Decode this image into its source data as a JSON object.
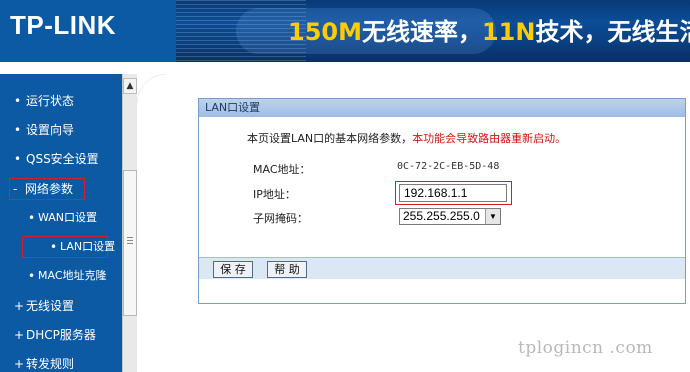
{
  "header": {
    "logo": "TP-LINK",
    "banner": {
      "part1": "150M",
      "part2": "无线速率，",
      "part3": "11N",
      "part4": "技术，无线生活"
    }
  },
  "sidebar": {
    "items": [
      {
        "label": "运行状态"
      },
      {
        "label": "设置向导"
      },
      {
        "label": "QSS安全设置"
      },
      {
        "label": "网络参数"
      },
      {
        "label": "WAN口设置"
      },
      {
        "label": "LAN口设置"
      },
      {
        "label": "MAC地址克隆"
      },
      {
        "label": "无线设置"
      },
      {
        "label": "DHCP服务器"
      },
      {
        "label": "转发规则"
      }
    ],
    "bullets": {
      "dot": "•",
      "minus": "-",
      "plus": "+"
    }
  },
  "scrollbar": {
    "up_arrow": "▲"
  },
  "panel": {
    "title": "LAN口设置",
    "description": "本页设置LAN口的基本网络参数，",
    "warning": "本功能会导致路由器重新启动。",
    "mac_label": "MAC地址：",
    "mac_value": "0C-72-2C-EB-5D-48",
    "ip_label": "IP地址：",
    "ip_value": "192.168.1.1",
    "mask_label": "子网掩码：",
    "mask_value": "255.255.255.0",
    "mask_arrow": "▼"
  },
  "buttons": {
    "save": "保 存",
    "help": "帮 助"
  },
  "watermark": "tplogincn .com",
  "colors": {
    "sidebar_bg": "#0b5aa3",
    "highlight_red": "#d21f2f",
    "warning_red": "#d01414",
    "title_bar": "#9fbde3",
    "banner_yellow": "#ffcc00"
  }
}
